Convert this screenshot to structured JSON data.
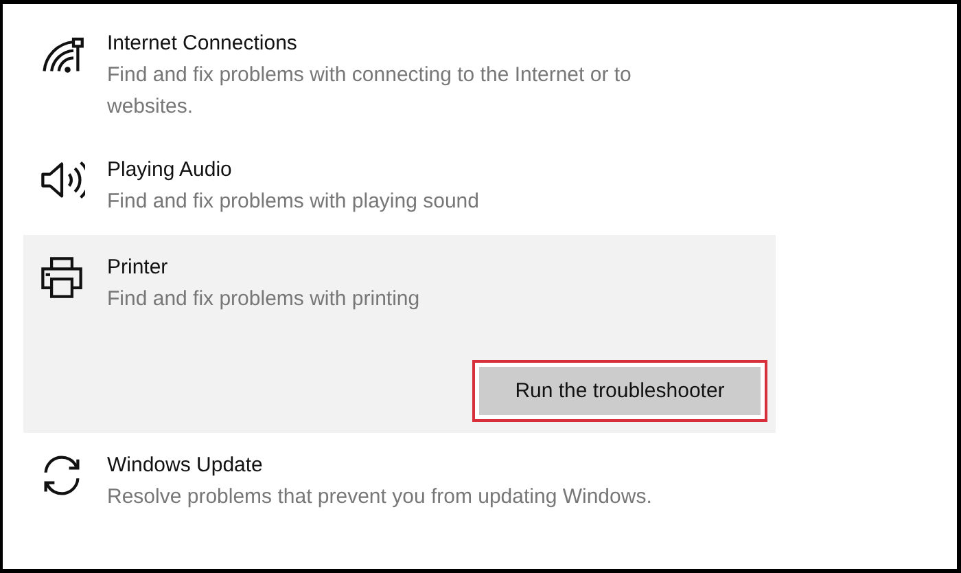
{
  "troubleshooters": [
    {
      "kind": "network",
      "title": "Internet Connections",
      "description": "Find and fix problems with connecting to the Internet or to websites.",
      "selected": false
    },
    {
      "kind": "audio",
      "title": "Playing Audio",
      "description": "Find and fix problems with playing sound",
      "selected": false
    },
    {
      "kind": "printer",
      "title": "Printer",
      "description": "Find and fix problems with printing",
      "selected": true,
      "button": {
        "label": "Run the troubleshooter",
        "highlighted": true
      }
    },
    {
      "kind": "update",
      "title": "Windows Update",
      "description": "Resolve problems that prevent you from updating Windows.",
      "selected": false
    }
  ]
}
